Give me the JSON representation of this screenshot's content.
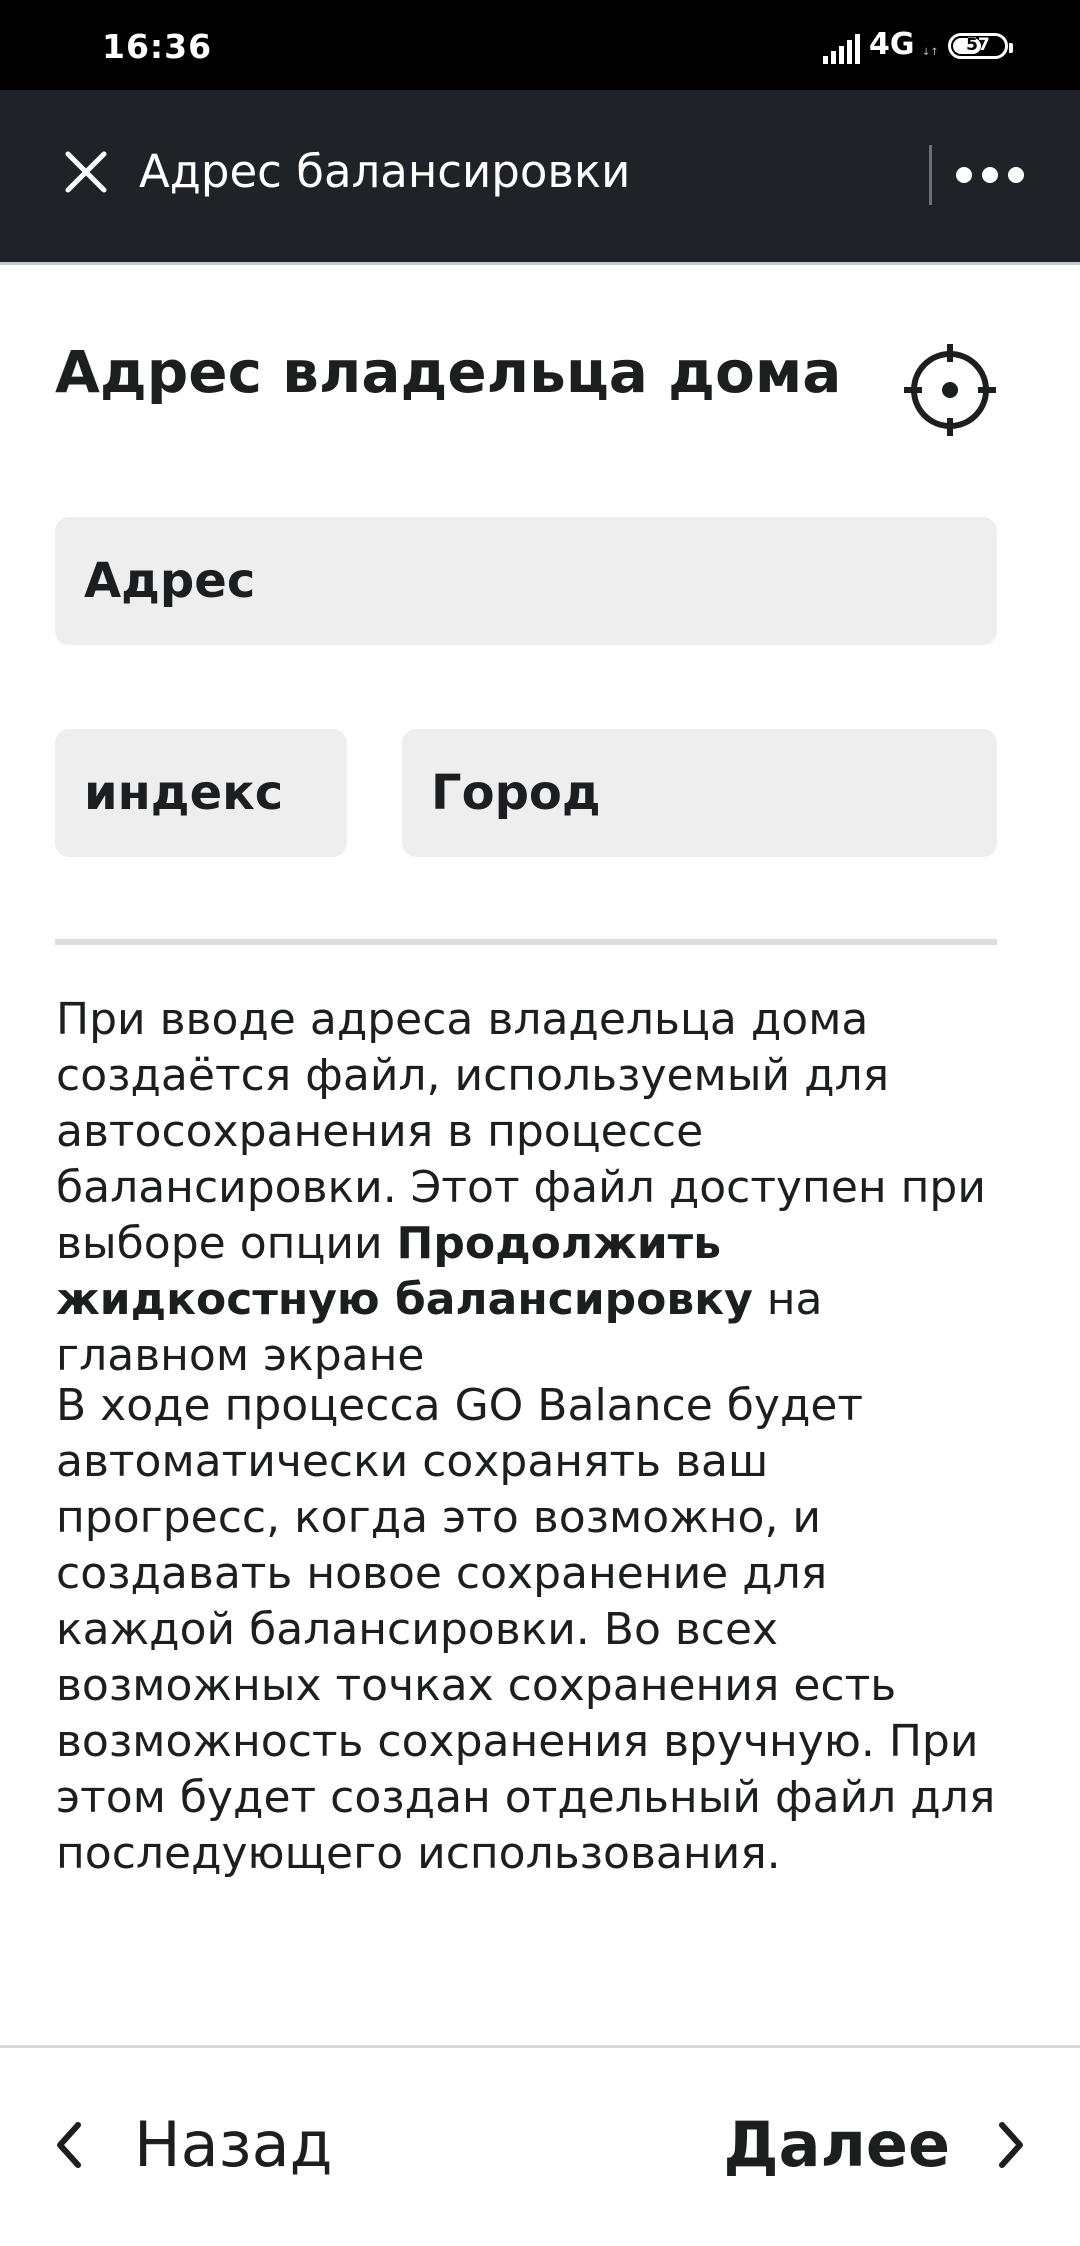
{
  "status_bar": {
    "time": "16:36",
    "network": "4G",
    "network_sub": "",
    "battery": "57",
    "battery_level": 0.57
  },
  "header": {
    "close_icon": "close-icon",
    "title": "Адрес балансировки",
    "more_icon": "more-horizontal-icon"
  },
  "main": {
    "section_title": "Адрес владельца дома",
    "locate_icon": "crosshair-locate-icon",
    "fields": {
      "address_placeholder": "Адрес",
      "zip_placeholder": "индекс",
      "city_placeholder": "Город"
    },
    "info": {
      "p1_before": "При вводе адреса владельца дома создаётся файл, используемый для автосохранения в процессе балансировки. Этот файл доступен при выборе опции ",
      "p1_bold": "Продолжить жидкостную балансировку",
      "p1_after": " на главном экране",
      "p2": "В ходе процесса GO Balance будет автоматически сохранять ваш прогресс, когда это возможно, и создавать новое сохранение для каждой балансировки. Во всех возможных точках сохранения есть возможность сохранения вручную. При этом будет создан отдельный файл для последующего использования."
    }
  },
  "footer": {
    "back_label": "Назад",
    "next_label": "Далее",
    "back_icon": "chevron-left-icon",
    "next_icon": "chevron-right-icon"
  },
  "colors": {
    "header_bg": "#1f2327",
    "status_bg": "#000000",
    "field_bg": "#eeeeee",
    "text": "#1c1e20"
  }
}
